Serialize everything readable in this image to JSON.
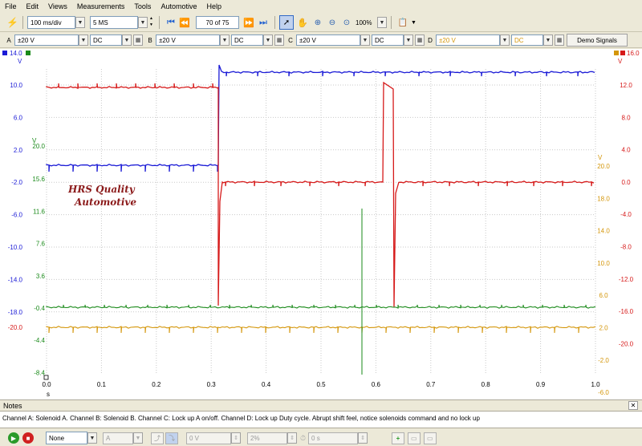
{
  "menu": [
    "File",
    "Edit",
    "Views",
    "Measurements",
    "Tools",
    "Automotive",
    "Help"
  ],
  "toolbar": {
    "timebase": "100 ms/div",
    "samples": "5 MS",
    "buffer": "70 of 75",
    "zoom": "100%"
  },
  "channels": [
    {
      "letter": "A",
      "range": "±20 V",
      "coupling": "DC",
      "color": "#1a1ad6"
    },
    {
      "letter": "B",
      "range": "±20 V",
      "coupling": "DC",
      "color": "#d61a1a"
    },
    {
      "letter": "C",
      "range": "±20 V",
      "coupling": "DC",
      "color": "#1a8a1a"
    },
    {
      "letter": "D",
      "range": "±20 V",
      "coupling": "DC",
      "color": "#d4960a"
    }
  ],
  "demo_signals": "Demo Signals",
  "scale_top": {
    "left": "14.0",
    "right": "16.0"
  },
  "axes": {
    "unit": "V",
    "x_unit": "s",
    "x_ticks": [
      "0.0",
      "0.1",
      "0.2",
      "0.3",
      "0.4",
      "0.5",
      "0.6",
      "0.7",
      "0.8",
      "0.9",
      "1.0"
    ],
    "left_blue": [
      "10.0",
      "6.0",
      "2.0",
      "-2.0",
      "-6.0",
      "-10.0",
      "-14.0",
      "-18.0"
    ],
    "left_green": [
      "20.0",
      "15.6",
      "11.6",
      "7.6",
      "3.6",
      "-0.4",
      "-4.4",
      "-8.4"
    ],
    "left_red_low": "-20.0",
    "right_red": [
      "12.0",
      "8.0",
      "4.0",
      "0.0",
      "-4.0",
      "-8.0",
      "-12.0",
      "-16.0",
      "-20.0"
    ],
    "right_orange": [
      "20.0",
      "18.0",
      "14.0",
      "10.0",
      "6.0",
      "2.0",
      "-2.0",
      "-6.0"
    ]
  },
  "watermark": {
    "line1": "HRS Quality",
    "line2": "Automotive"
  },
  "notes": {
    "title": "Notes",
    "text": "Channel A: Solenoid A.   Channel B: Solenoid B.   Channel C: Lock up A  on/off.   Channel D: Lock up Duty cycle.      Abrupt shift feel, notice solenoids command and no lock up"
  },
  "statusbar": {
    "trigger_mode": "None",
    "trigger_channel": "A",
    "threshold": "0 V",
    "pretrigger": "2%",
    "delay": "0 s"
  }
}
